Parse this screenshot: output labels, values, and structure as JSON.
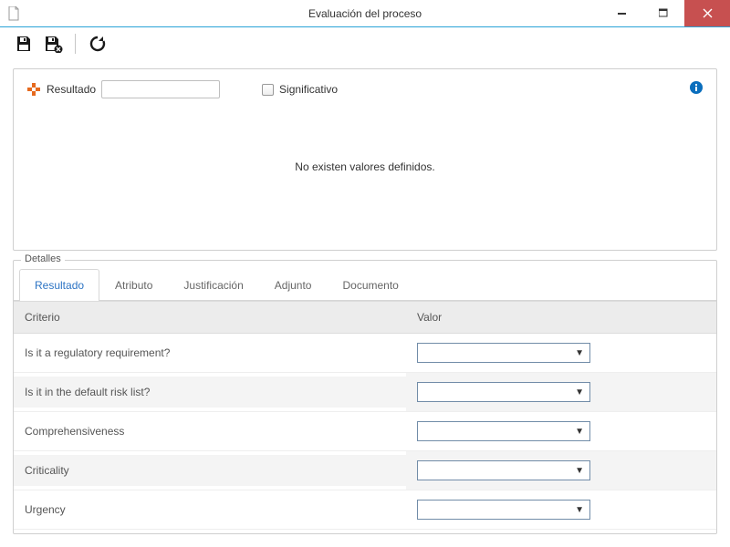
{
  "window": {
    "title": "Evaluación del proceso"
  },
  "toolbar": {
    "save": "Save",
    "saveClose": "Save and close",
    "refresh": "Refresh"
  },
  "topPanel": {
    "resultLabel": "Resultado",
    "resultValue": "",
    "significantLabel": "Significativo",
    "emptyMessage": "No existen valores definidos."
  },
  "details": {
    "legend": "Detalles",
    "tabs": [
      "Resultado",
      "Atributo",
      "Justificación",
      "Adjunto",
      "Documento"
    ],
    "activeTab": 0,
    "columns": {
      "criterion": "Criterio",
      "value": "Valor"
    },
    "rows": [
      {
        "criterion": "Is it a regulatory requirement?",
        "value": ""
      },
      {
        "criterion": "Is it in the default risk list?",
        "value": ""
      },
      {
        "criterion": "Comprehensiveness",
        "value": ""
      },
      {
        "criterion": "Criticality",
        "value": ""
      },
      {
        "criterion": "Urgency",
        "value": ""
      }
    ]
  }
}
